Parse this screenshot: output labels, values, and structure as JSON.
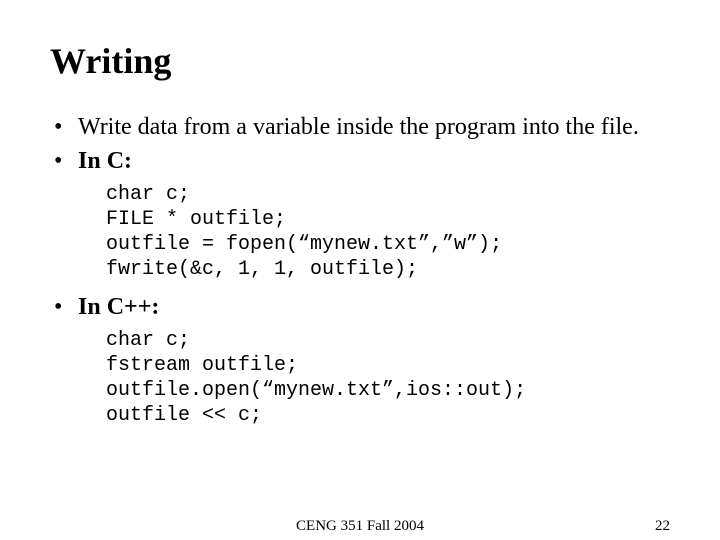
{
  "title": "Writing",
  "bullet1": "Write data from a variable inside the program into the file.",
  "bullet2": "In C:",
  "code_c": "char c;\nFILE * outfile;\noutfile = fopen(“mynew.txt”,”w”);\nfwrite(&c, 1, 1, outfile);",
  "bullet3": "In C++:",
  "code_cpp": "char c;\nfstream outfile;\noutfile.open(“mynew.txt”,ios::out);\noutfile << c;",
  "footer_center": "CENG 351 Fall 2004",
  "footer_right": "22"
}
